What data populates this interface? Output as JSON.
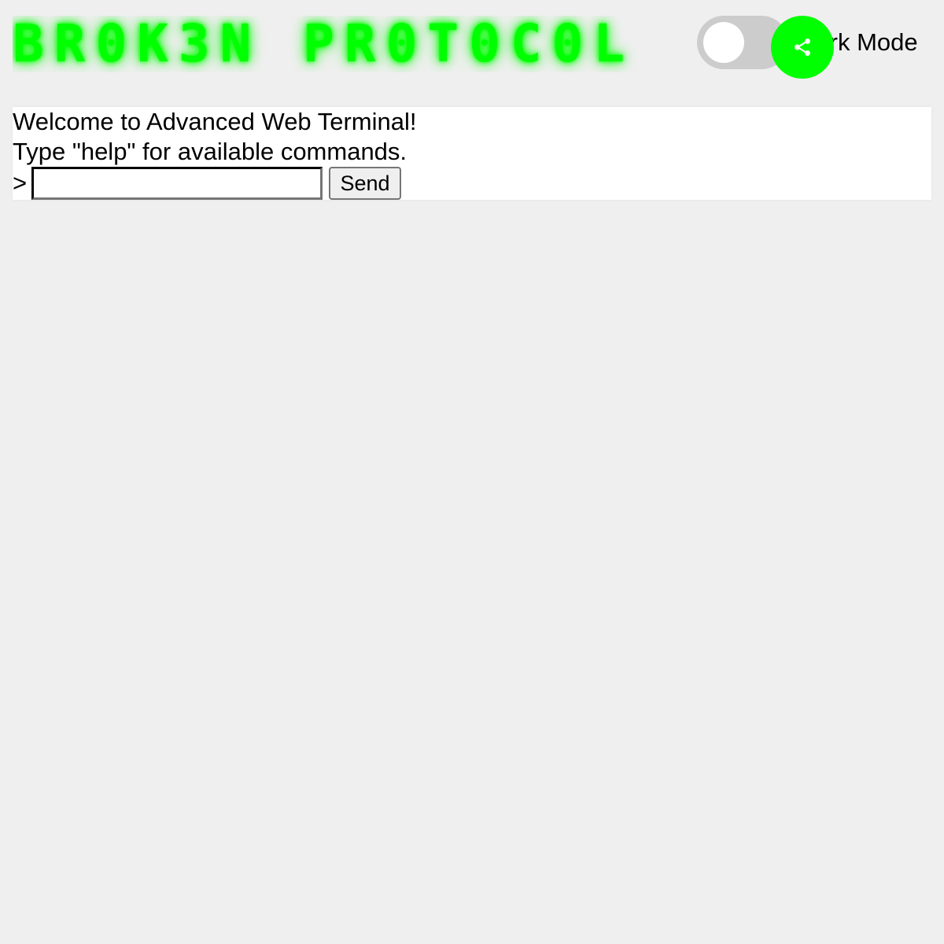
{
  "header": {
    "logo_text": "BR0K3N PR0T0C0L",
    "toggle_label": "Dark Mode",
    "toggle_state": "off"
  },
  "share": {
    "icon": "share-icon"
  },
  "terminal": {
    "lines": [
      "Welcome to Advanced Web Terminal!",
      "Type \"help\" for available commands."
    ],
    "prompt": ">",
    "input_value": "",
    "send_label": "Send"
  },
  "colors": {
    "accent": "#00ff00",
    "background": "#efefef",
    "terminal_bg": "#ffffff",
    "toggle_track": "#cccccc"
  }
}
